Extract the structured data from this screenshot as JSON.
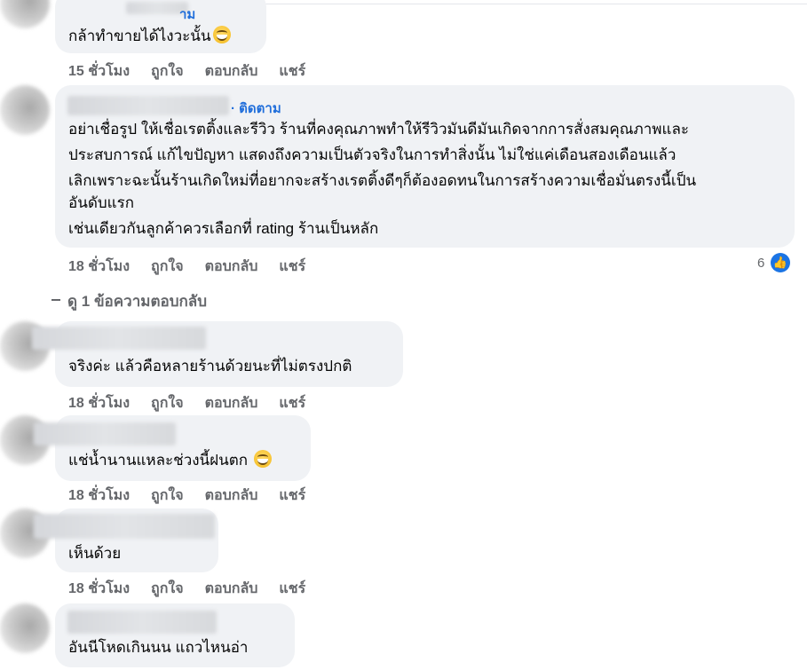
{
  "actions": {
    "like": "ถูกใจ",
    "reply": "ตอบกลับ",
    "share": "แชร์"
  },
  "comments": [
    {
      "text": "กล้าทำขายได้ไงวะนั้น",
      "time": "15 ชั่วโมง",
      "name_fragment": "าม"
    },
    {
      "follow": "ติดตาม",
      "lines": [
        "อย่าเชื่อรูป ให้เชื่อเรตติ้งและรีวิว ร้านที่คงคุณภาพทำให้รีวิวมันดีมันเกิดจากการสั่งสมคุณภาพและ",
        "ประสบการณ์ แก้ไขปัญหา แสดงถึงความเป็นตัวจริงในการทำสิ่งนั้น ไม่ใช่แค่เดือนสองเดือนแล้ว",
        "เลิกเพราะฉะนั้นร้านเกิดใหม่ที่อยากจะสร้างเรตติ้งดีๆก็ต้องอดทนในการสร้างความเชื่อมั่นตรงนี้เป็น",
        "อันดับแรก",
        "เช่นเดียวกันลูกค้าควรเลือกที่ rating ร้านเป็นหลัก"
      ],
      "time": "18 ชั่วโมง",
      "like_count": "6"
    },
    {
      "text": "จริงค่ะ แล้วคือหลายร้านด้วยนะที่ไม่ตรงปกติ",
      "time": "18 ชั่วโมง"
    },
    {
      "text": "แช่น้ำนานแหละช่วงนี้ฝนตก",
      "time": "18 ชั่วโมง"
    },
    {
      "text": "เห็นด้วย",
      "time": "18 ชั่วโมง"
    },
    {
      "text": "อันนีโหดเกินนน แถวไหนอ่า"
    }
  ],
  "view_replies": "ดู 1 ข้อความตอบกลับ",
  "colors": {
    "bubble": "#f0f2f5",
    "link": "#216fdb",
    "meta": "#65676b",
    "like_blue": "#1b74e4"
  },
  "icons": [
    "grinning-sweat-emoji-icon",
    "thumbs-up-icon",
    "reply-arrow-icon"
  ]
}
